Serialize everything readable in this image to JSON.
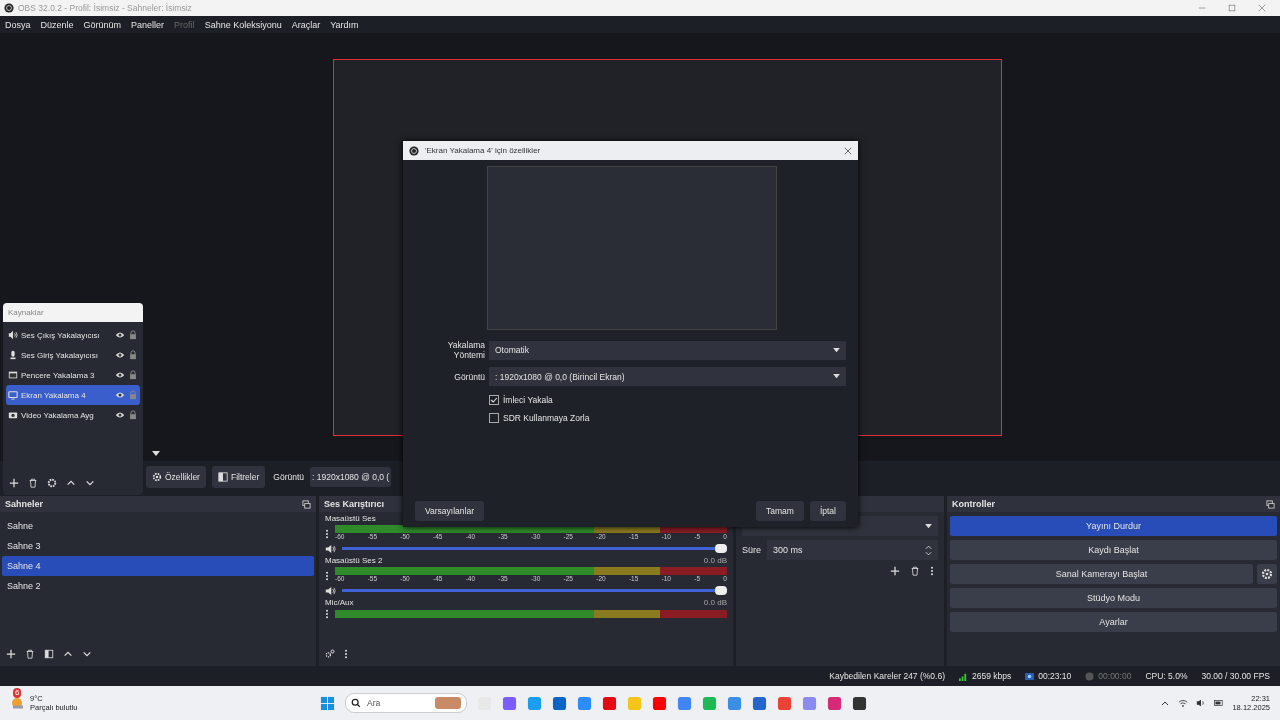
{
  "window": {
    "title": "OBS 32.0.2 - Profil: İsimsiz - Sahneler: İsimsiz"
  },
  "menu": [
    {
      "label": "Dosya",
      "disabled": false
    },
    {
      "label": "Düzenle",
      "disabled": false
    },
    {
      "label": "Görünüm",
      "disabled": false
    },
    {
      "label": "Paneller",
      "disabled": false
    },
    {
      "label": "Profil",
      "disabled": true
    },
    {
      "label": "Sahne Koleksiyonu",
      "disabled": false
    },
    {
      "label": "Araçlar",
      "disabled": false
    },
    {
      "label": "Yardım",
      "disabled": false
    }
  ],
  "sources": {
    "title": "Kaynaklar",
    "items": [
      {
        "name": "Ses Çıkış Yakalayıcısı",
        "kind": "speaker",
        "selected": false
      },
      {
        "name": "Ses Giriş Yakalayıcısı",
        "kind": "mic",
        "selected": false
      },
      {
        "name": "Pencere Yakalama 3",
        "kind": "window",
        "selected": false
      },
      {
        "name": "Ekran Yakalama 4",
        "kind": "display",
        "selected": true
      },
      {
        "name": "Video Yakalama Ayg",
        "kind": "camera",
        "selected": false
      }
    ]
  },
  "toolbar": {
    "properties": "Özellikler",
    "filters": "Filtreler",
    "display_label": "Görüntü",
    "display_value": ": 1920x1080 @ 0,0 ("
  },
  "scenes": {
    "title": "Sahneler",
    "items": [
      {
        "name": "Sahne",
        "selected": false
      },
      {
        "name": "Sahne 3",
        "selected": false
      },
      {
        "name": "Sahne 4",
        "selected": true
      },
      {
        "name": "Sahne 2",
        "selected": false
      }
    ]
  },
  "mixer": {
    "title": "Ses Karıştırıcı",
    "channels": [
      {
        "name": "Masaüstü Ses",
        "scale": [
          "-60",
          "-55",
          "-50",
          "-45",
          "-40",
          "-35",
          "-30",
          "-25",
          "-20",
          "-15",
          "-10",
          "-5",
          "0"
        ],
        "level": 1
      },
      {
        "name": "Masaüstü Ses 2",
        "reading": "0.0 dB",
        "scale": [
          "-60",
          "-55",
          "-50",
          "-45",
          "-40",
          "-35",
          "-30",
          "-25",
          "-20",
          "-15",
          "-10",
          "-5",
          "0"
        ],
        "level": 1
      },
      {
        "name": "Mic/Aux",
        "reading": "0.0 dB"
      }
    ]
  },
  "transitions": {
    "duration_label": "Süre",
    "duration": "300 ms"
  },
  "controls": {
    "title": "Kontroller",
    "buttons": [
      {
        "label": "Yayını Durdur",
        "active": true
      },
      {
        "label": "Kaydı Başlat",
        "active": false
      },
      {
        "label": "Sanal Kamerayı Başlat",
        "active": false
      },
      {
        "label": "Stüdyo Modu",
        "active": false
      },
      {
        "label": "Ayarlar",
        "active": false
      }
    ]
  },
  "dialog": {
    "title": "'Ekran Yakalama 4' için özellikler",
    "fields": [
      {
        "label": "Yakalama Yöntemi",
        "value": "Otomatik"
      },
      {
        "label": "Görüntü",
        "value": ": 1920x1080 @ 0,0 (Birincil Ekran)"
      }
    ],
    "checkboxes": [
      {
        "label": "İmleci Yakala",
        "checked": true
      },
      {
        "label": "SDR Kullanmaya Zorla",
        "checked": false
      }
    ],
    "defaults": "Varsayılanlar",
    "ok": "Tamam",
    "cancel": "İptal"
  },
  "status_bar": {
    "dropped": "Kaybedilen Kareler 247 (%0.6)",
    "bitrate": "2659 kbps",
    "stream_time": "00:23:10",
    "record_time": "00:00:00",
    "cpu": "CPU: 5.0%",
    "fps": "30.00 / 30.00 FPS"
  },
  "taskbar": {
    "weather_badge": "6",
    "temperature": "9°C",
    "weather": "Parçalı bulutlu",
    "search": "Ara",
    "time": "22:31",
    "date": "18.12.2025"
  }
}
